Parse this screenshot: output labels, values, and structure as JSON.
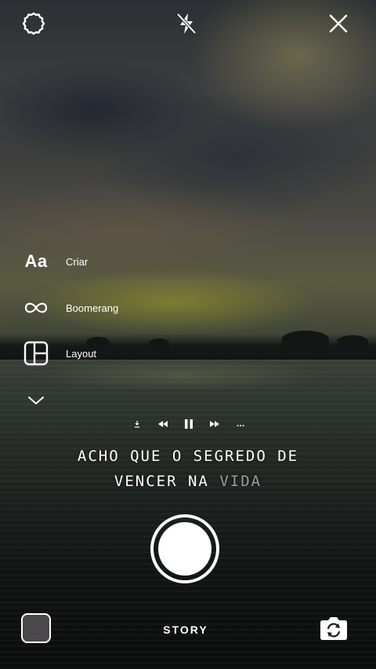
{
  "camera": {
    "tools": [
      {
        "icon": "text-create-icon",
        "glyph": "Aa",
        "label": "Criar"
      },
      {
        "icon": "boomerang-icon",
        "label": "Boomerang"
      },
      {
        "icon": "layout-icon",
        "label": "Layout"
      }
    ],
    "expand_icon": "chevron-down-icon"
  },
  "music": {
    "controls": [
      "download-icon",
      "rewind-icon",
      "pause-icon",
      "fast-forward-icon",
      "more-icon"
    ],
    "lyrics": {
      "line1": "ACHO QUE O SEGREDO DE",
      "line2_main": "VENCER NA ",
      "line2_dim": "VIDA"
    }
  },
  "bottom": {
    "mode": "STORY"
  },
  "colors": {
    "icon": "#ffffff",
    "lyric_dim": "#9a9e9c"
  }
}
